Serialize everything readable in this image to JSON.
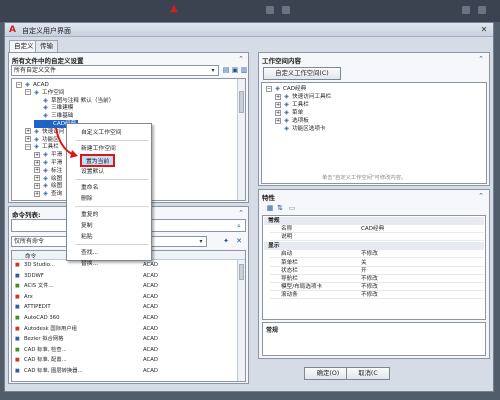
{
  "window": {
    "title": "自定义用户界面",
    "close_glyph": "✕",
    "app_icon": "autocad-a-icon"
  },
  "tabs": [
    "自定义",
    "传输"
  ],
  "left_pane": {
    "header": "所有文件中的自定义设置",
    "file_combo": "所有自定义文件",
    "tree": [
      {
        "label": "ACAD",
        "level": 0,
        "toggle": "−"
      },
      {
        "label": "工作空间",
        "level": 1,
        "toggle": "−"
      },
      {
        "label": "草图与注释 默认（当前）",
        "level": 2
      },
      {
        "label": "三维建模",
        "level": 2
      },
      {
        "label": "三维基础",
        "level": 2
      },
      {
        "label": "CAD经典",
        "level": 2,
        "selected": true
      },
      {
        "label": "快速访问",
        "level": 1,
        "toggle": "+"
      },
      {
        "label": "功能区",
        "level": 1,
        "toggle": "+"
      },
      {
        "label": "工具栏",
        "level": 1,
        "toggle": "−"
      },
      {
        "label": "平滑",
        "level": 2,
        "toggle": "+"
      },
      {
        "label": "平滑",
        "level": 2,
        "toggle": "+"
      },
      {
        "label": "标注",
        "level": 2,
        "toggle": "+"
      },
      {
        "label": "绘图",
        "level": 2,
        "toggle": "+"
      },
      {
        "label": "绘图",
        "level": 2,
        "toggle": "+"
      },
      {
        "label": "查询",
        "level": 2,
        "toggle": "+"
      }
    ]
  },
  "context_menu": {
    "items": [
      {
        "label": "自定义工作空间",
        "kind": "item"
      },
      {
        "label": "",
        "kind": "sep"
      },
      {
        "label": "新建工作空间",
        "kind": "item"
      },
      {
        "label": "置为当前",
        "kind": "item",
        "highlight": true
      },
      {
        "label": "设置默认",
        "kind": "item"
      },
      {
        "label": "",
        "kind": "sep"
      },
      {
        "label": "重命名",
        "kind": "item"
      },
      {
        "label": "删除",
        "kind": "item"
      },
      {
        "label": "",
        "kind": "sep"
      },
      {
        "label": "重复的",
        "kind": "item"
      },
      {
        "label": "复制",
        "kind": "item"
      },
      {
        "label": "粘贴",
        "kind": "item"
      },
      {
        "label": "",
        "kind": "sep"
      },
      {
        "label": "查找...",
        "kind": "item"
      },
      {
        "label": "替换...",
        "kind": "item"
      }
    ]
  },
  "command_list": {
    "header": "命令列表:",
    "filter": "仅所有命令",
    "col_command": "命令",
    "col_source": "源",
    "rows": [
      {
        "name": "3D Studio...",
        "src": "ACAD"
      },
      {
        "name": "3DDWF",
        "src": "ACAD"
      },
      {
        "name": "ACIS 文件...",
        "src": "ACAD"
      },
      {
        "name": "Arx",
        "src": "ACAD"
      },
      {
        "name": "ATTIPEDIT",
        "src": "ACAD"
      },
      {
        "name": "AutoCAD 360",
        "src": "ACAD"
      },
      {
        "name": "Autodesk 国际用户组",
        "src": "ACAD"
      },
      {
        "name": "Bezier 拟合网格",
        "src": "ACAD"
      },
      {
        "name": "CAD 标准, 检查...",
        "src": "ACAD"
      },
      {
        "name": "CAD 标准, 配置...",
        "src": "ACAD"
      },
      {
        "name": "CAD 标准, 图层转换器...",
        "src": "ACAD"
      }
    ]
  },
  "right_top": {
    "header": "工作空间内容",
    "button": "自定义工作空间(C)",
    "tree": [
      {
        "label": "CAD经典",
        "level": 0,
        "toggle": "−"
      },
      {
        "label": "快速访问工具栏",
        "level": 1,
        "toggle": "+"
      },
      {
        "label": "工具栏",
        "level": 1,
        "toggle": "+"
      },
      {
        "label": "菜单",
        "level": 1,
        "toggle": "+"
      },
      {
        "label": "选项板",
        "level": 1,
        "toggle": "+"
      },
      {
        "label": "功能区选项卡",
        "level": 1
      }
    ],
    "hint": "单击\"自定义工作空间\"可修改内容。"
  },
  "properties": {
    "header": "特性",
    "sections": [
      {
        "name": "常规",
        "rows": [
          {
            "k": "名称",
            "v": "CAD经典"
          },
          {
            "k": "说明",
            "v": ""
          }
        ]
      },
      {
        "name": "显示",
        "rows": [
          {
            "k": "启动",
            "v": "不修改"
          },
          {
            "k": "菜单栏",
            "v": "关"
          },
          {
            "k": "状态栏",
            "v": "开"
          },
          {
            "k": "导航栏",
            "v": "不修改"
          },
          {
            "k": "模型/布局选项卡",
            "v": "不修改"
          },
          {
            "k": "滚动条",
            "v": "不修改"
          }
        ]
      }
    ],
    "footer": "常规"
  },
  "footer_buttons": {
    "ok": "确定(O)",
    "cancel": "取消(C"
  },
  "colors": {
    "highlight_border": "#d81818",
    "selection": "#c7ddf6",
    "accent": "#2a5ea8"
  }
}
